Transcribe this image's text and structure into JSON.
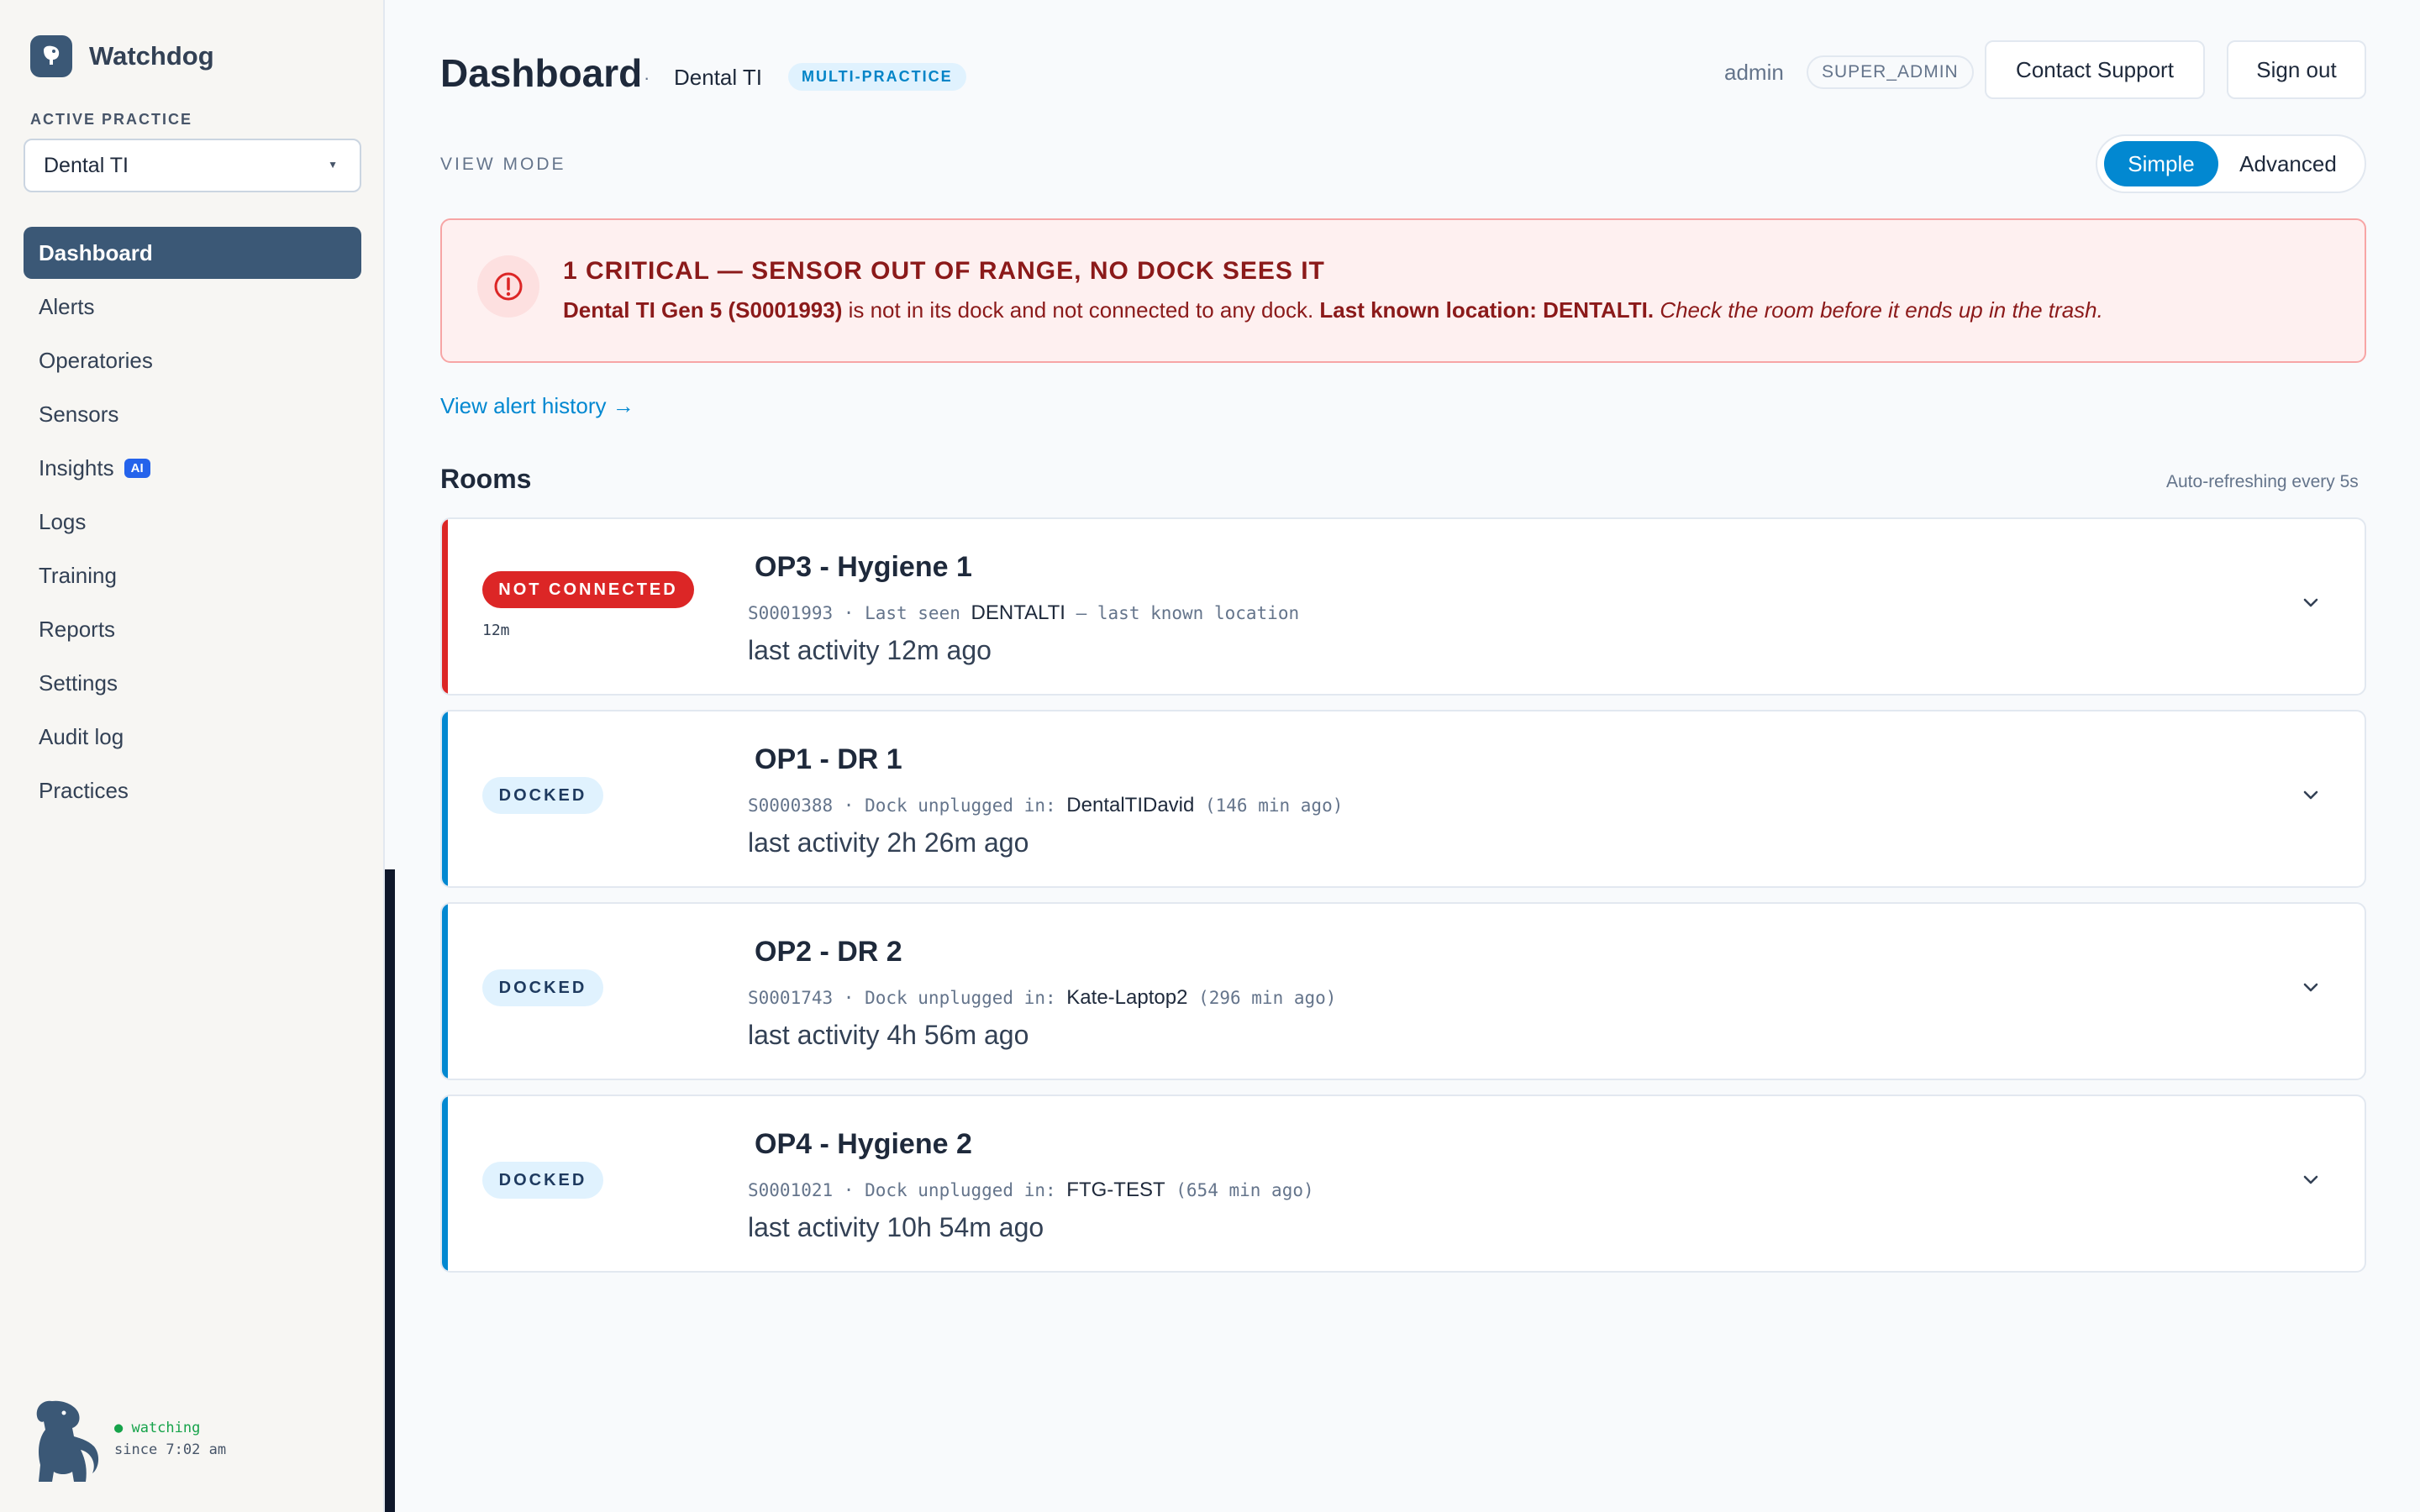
{
  "brand": {
    "name": "Watchdog"
  },
  "sidebar": {
    "active_practice_label": "ACTIVE PRACTICE",
    "practice_selected": "Dental TI",
    "items": [
      {
        "label": "Dashboard",
        "active": true
      },
      {
        "label": "Alerts"
      },
      {
        "label": "Operatories"
      },
      {
        "label": "Sensors"
      },
      {
        "label": "Insights",
        "badge": "AI"
      },
      {
        "label": "Logs"
      },
      {
        "label": "Training"
      },
      {
        "label": "Reports"
      },
      {
        "label": "Settings"
      },
      {
        "label": "Audit log"
      },
      {
        "label": "Practices"
      }
    ],
    "status": {
      "watching": "● watching",
      "since": "since 7:02 am"
    }
  },
  "header": {
    "title": "Dashboard",
    "separator": "·",
    "practice": "Dental TI",
    "practice_badge": "MULTI-PRACTICE",
    "user": "admin",
    "role": "SUPER_ADMIN",
    "contact_label": "Contact Support",
    "signout_label": "Sign out"
  },
  "view_mode": {
    "label": "VIEW MODE",
    "options": [
      "Simple",
      "Advanced"
    ],
    "selected": "Simple"
  },
  "alert": {
    "title": "1 CRITICAL — SENSOR OUT OF RANGE, NO DOCK SEES IT",
    "device": "Dental TI Gen 5 (S0001993)",
    "middle": " is not in its dock and not connected to any dock. ",
    "location": "Last known location: DENTALTI.",
    "advice": " Check the room before it ends up in the trash."
  },
  "history_link": "View alert history →",
  "rooms": {
    "title": "Rooms",
    "refresh_note": "Auto-refreshing every 5s",
    "items": [
      {
        "status": "NOT CONNECTED",
        "status_sub": "12m",
        "name": "OP3 - Hygiene 1",
        "meta_prefix": "S0001993 · Last seen ",
        "meta_host": "DENTALTI",
        "meta_suffix": " — last known location",
        "activity": "last activity 12m ago"
      },
      {
        "status": "DOCKED",
        "status_sub": "",
        "name": "OP1 - DR 1",
        "meta_prefix": "S0000388 · Dock unplugged in: ",
        "meta_host": "DentalTIDavid",
        "meta_suffix": " (146 min ago)",
        "activity": "last activity 2h 26m ago"
      },
      {
        "status": "DOCKED",
        "status_sub": "",
        "name": "OP2 - DR 2",
        "meta_prefix": "S0001743 · Dock unplugged in: ",
        "meta_host": "Kate-Laptop2",
        "meta_suffix": " (296 min ago)",
        "activity": "last activity 4h 56m ago"
      },
      {
        "status": "DOCKED",
        "status_sub": "",
        "name": "OP4 - Hygiene 2",
        "meta_prefix": "S0001021 · Dock unplugged in: ",
        "meta_host": "FTG-TEST",
        "meta_suffix": " (654 min ago)",
        "activity": "last activity 10h 54m ago"
      }
    ]
  },
  "colors": {
    "accent": "#0288d1",
    "nav_active": "#3b5876",
    "critical": "#dc2626",
    "docked_stripe": "#0288d1"
  }
}
